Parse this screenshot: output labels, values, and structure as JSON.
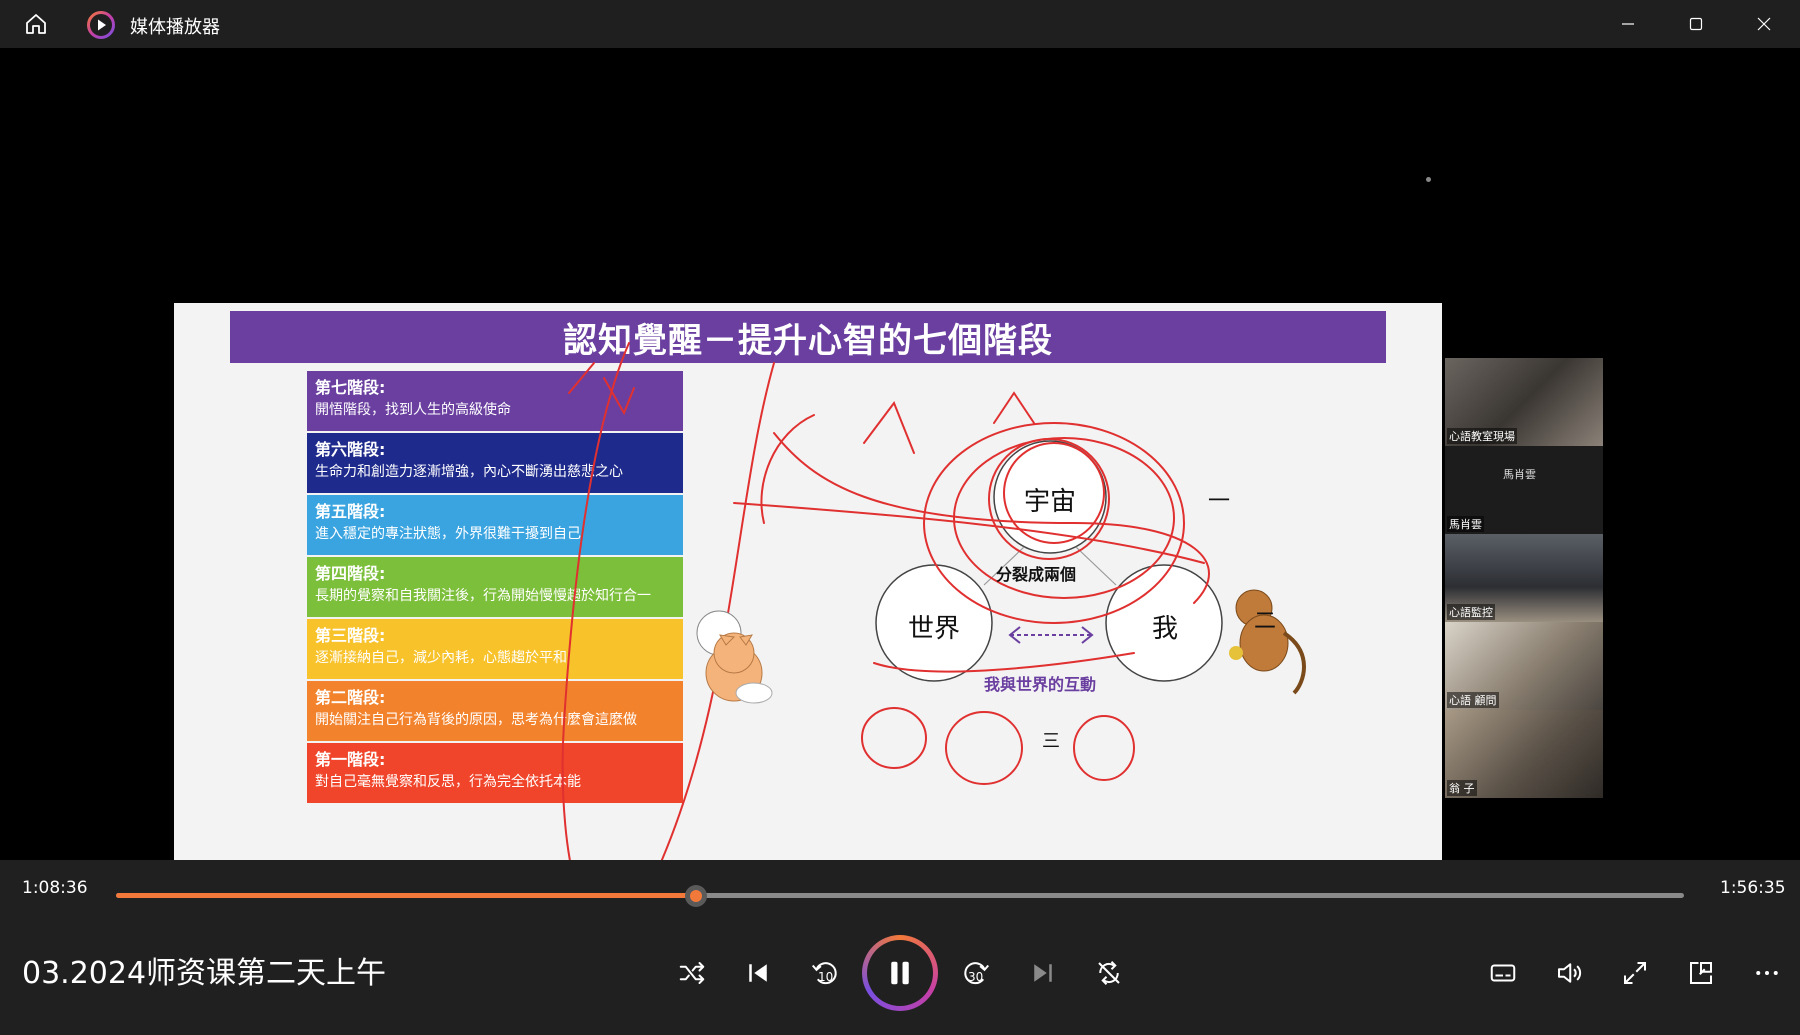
{
  "window": {
    "title": "媒体播放器",
    "controls": [
      "minimize",
      "maximize",
      "close"
    ]
  },
  "slide": {
    "title": "認知覺醒－提升心智的七個階段",
    "stages": [
      {
        "title": "第七階段:",
        "desc": "開悟階段，找到人生的高級使命",
        "color": "#6a3fa0"
      },
      {
        "title": "第六階段:",
        "desc": "生命力和創造力逐漸增強，內心不斷湧出慈悲之心",
        "color": "#1f2b8c"
      },
      {
        "title": "第五階段:",
        "desc": "進入穩定的專注狀態，外界很難干擾到自己",
        "color": "#3aa4e0"
      },
      {
        "title": "第四階段:",
        "desc": "長期的覺察和自我關注後，行為開始慢慢趨於知行合一",
        "color": "#7cbf3a"
      },
      {
        "title": "第三階段:",
        "desc": "逐漸接納自己，減少內耗，心態趨於平和",
        "color": "#f7c22a"
      },
      {
        "title": "第二階段:",
        "desc": "開始關注自己行為背後的原因，思考為什麼會這麼做",
        "color": "#f2822c"
      },
      {
        "title": "第一階段:",
        "desc": "對自己毫無覺察和反思，行為完全依托本能",
        "color": "#f0452a"
      }
    ],
    "circles": {
      "top": "宇宙",
      "left": "世界",
      "right": "我"
    },
    "split_label": "分裂成兩個",
    "interaction_label": "我與世界的互動",
    "marks": {
      "one": "一",
      "two": "二",
      "three": "三"
    }
  },
  "participants": [
    {
      "label": "心語教室現場"
    },
    {
      "label": "馬肖雲",
      "name_tag": "馬肖雲"
    },
    {
      "label": "心語監控"
    },
    {
      "label": "心語 顧問"
    },
    {
      "label": "翁 子"
    }
  ],
  "player": {
    "elapsed": "1:08:36",
    "total": "1:56:35",
    "progress": 0.37,
    "media_title": "03.2024师资课第二天上午",
    "skip_back_seconds": "10",
    "skip_forward_seconds": "30"
  },
  "colors": {
    "accent": "#f2793a",
    "slide_header": "#6a3fa0"
  }
}
